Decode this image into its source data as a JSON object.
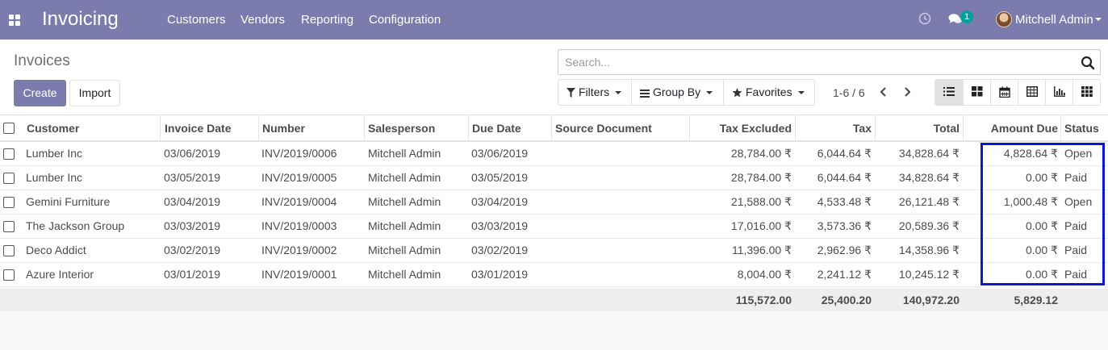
{
  "navbar": {
    "app_title": "Invoicing",
    "menu": [
      "Customers",
      "Vendors",
      "Reporting",
      "Configuration"
    ],
    "chat_badge": "1",
    "user_name": "Mitchell Admin"
  },
  "control_panel": {
    "page_title": "Invoices",
    "create_label": "Create",
    "import_label": "Import",
    "search_placeholder": "Search...",
    "filters_label": "Filters",
    "group_by_label": "Group By",
    "favorites_label": "Favorites",
    "pager": "1-6 / 6"
  },
  "table": {
    "columns": [
      "Customer",
      "Invoice Date",
      "Number",
      "Salesperson",
      "Due Date",
      "Source Document",
      "Tax Excluded",
      "Tax",
      "Total",
      "Amount Due",
      "Status"
    ],
    "rows": [
      {
        "customer": "Lumber Inc",
        "invoice_date": "03/06/2019",
        "number": "INV/2019/0006",
        "salesperson": "Mitchell Admin",
        "due_date": "03/06/2019",
        "source": "",
        "tax_excluded": "28,784.00 ₹",
        "tax": "6,044.64 ₹",
        "total": "34,828.64 ₹",
        "amount_due": "4,828.64 ₹",
        "status": "Open"
      },
      {
        "customer": "Lumber Inc",
        "invoice_date": "03/05/2019",
        "number": "INV/2019/0005",
        "salesperson": "Mitchell Admin",
        "due_date": "03/05/2019",
        "source": "",
        "tax_excluded": "28,784.00 ₹",
        "tax": "6,044.64 ₹",
        "total": "34,828.64 ₹",
        "amount_due": "0.00 ₹",
        "status": "Paid"
      },
      {
        "customer": "Gemini Furniture",
        "invoice_date": "03/04/2019",
        "number": "INV/2019/0004",
        "salesperson": "Mitchell Admin",
        "due_date": "03/04/2019",
        "source": "",
        "tax_excluded": "21,588.00 ₹",
        "tax": "4,533.48 ₹",
        "total": "26,121.48 ₹",
        "amount_due": "1,000.48 ₹",
        "status": "Open"
      },
      {
        "customer": "The Jackson Group",
        "invoice_date": "03/03/2019",
        "number": "INV/2019/0003",
        "salesperson": "Mitchell Admin",
        "due_date": "03/03/2019",
        "source": "",
        "tax_excluded": "17,016.00 ₹",
        "tax": "3,573.36 ₹",
        "total": "20,589.36 ₹",
        "amount_due": "0.00 ₹",
        "status": "Paid"
      },
      {
        "customer": "Deco Addict",
        "invoice_date": "03/02/2019",
        "number": "INV/2019/0002",
        "salesperson": "Mitchell Admin",
        "due_date": "03/02/2019",
        "source": "",
        "tax_excluded": "11,396.00 ₹",
        "tax": "2,962.96 ₹",
        "total": "14,358.96 ₹",
        "amount_due": "0.00 ₹",
        "status": "Paid"
      },
      {
        "customer": "Azure Interior",
        "invoice_date": "03/01/2019",
        "number": "INV/2019/0001",
        "salesperson": "Mitchell Admin",
        "due_date": "03/01/2019",
        "source": "",
        "tax_excluded": "8,004.00 ₹",
        "tax": "2,241.12 ₹",
        "total": "10,245.12 ₹",
        "amount_due": "0.00 ₹",
        "status": "Paid"
      }
    ],
    "totals": {
      "tax_excluded": "115,572.00",
      "tax": "25,400.20",
      "total": "140,972.20",
      "amount_due": "5,829.12"
    }
  },
  "colors": {
    "navbar": "#7c7bad",
    "primary_button": "#7c7bad",
    "highlight_box": "#0e18c8",
    "badge": "#00a09d"
  },
  "icons": [
    "apps-icon",
    "clock-icon",
    "chat-icon",
    "avatar",
    "search-icon",
    "filter-icon",
    "list-icon",
    "star-icon",
    "chevron-left-icon",
    "chevron-right-icon",
    "list-view-icon",
    "kanban-view-icon",
    "calendar-view-icon",
    "pivot-view-icon",
    "graph-view-icon",
    "activity-view-icon"
  ]
}
